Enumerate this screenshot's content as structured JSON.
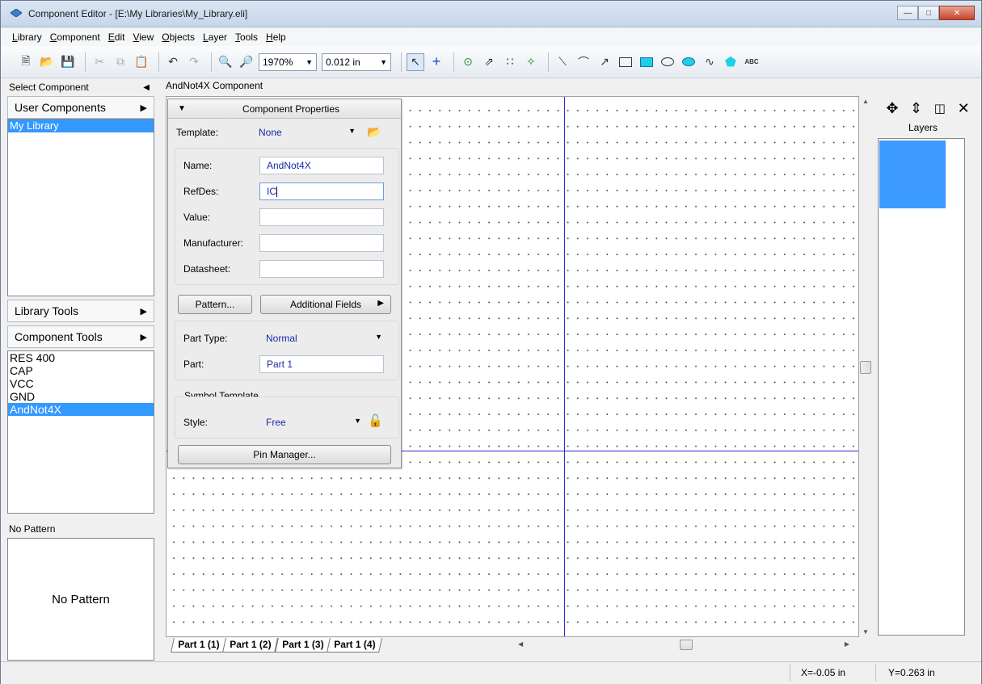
{
  "window": {
    "title": "Component Editor - [E:\\My Libraries\\My_Library.eli]"
  },
  "menu": [
    "Library",
    "Component",
    "Edit",
    "View",
    "Objects",
    "Layer",
    "Tools",
    "Help"
  ],
  "toolbar": {
    "zoom": "1970%",
    "grid": "0.012 in"
  },
  "left_panel": {
    "header": "Select Component",
    "user_components": "User Components",
    "libraries": [
      {
        "label": "My Library",
        "selected": true
      }
    ],
    "library_tools": "Library Tools",
    "component_tools": "Component Tools",
    "components": [
      {
        "label": "RES 400",
        "selected": false
      },
      {
        "label": "CAP",
        "selected": false
      },
      {
        "label": "VCC",
        "selected": false
      },
      {
        "label": "GND",
        "selected": false
      },
      {
        "label": "AndNot4X",
        "selected": true
      }
    ],
    "pattern_header": "No Pattern",
    "pattern_preview": "No Pattern"
  },
  "canvas": {
    "title": "AndNot4X Component"
  },
  "properties": {
    "title": "Component Properties",
    "template_label": "Template:",
    "template_value": "None",
    "name_label": "Name:",
    "name_value": "AndNot4X",
    "refdes_label": "RefDes:",
    "refdes_value": "IC",
    "value_label": "Value:",
    "value_value": "",
    "manufacturer_label": "Manufacturer:",
    "manufacturer_value": "",
    "datasheet_label": "Datasheet:",
    "datasheet_value": "",
    "pattern_button": "Pattern...",
    "additional_fields_button": "Additional Fields",
    "part_type_label": "Part Type:",
    "part_type_value": "Normal",
    "part_label": "Part:",
    "part_value": "Part 1",
    "symbol_template_label": "Symbol Template",
    "style_label": "Style:",
    "style_value": "Free",
    "pin_manager_button": "Pin Manager..."
  },
  "tabs": [
    "Part 1 (1)",
    "Part 1 (2)",
    "Part 1 (3)",
    "Part 1 (4)"
  ],
  "right_panel": {
    "layers_title": "Layers",
    "layer_color": "#3d9bff"
  },
  "status": {
    "x": "X=-0.05 in",
    "y": "Y=0.263 in"
  }
}
